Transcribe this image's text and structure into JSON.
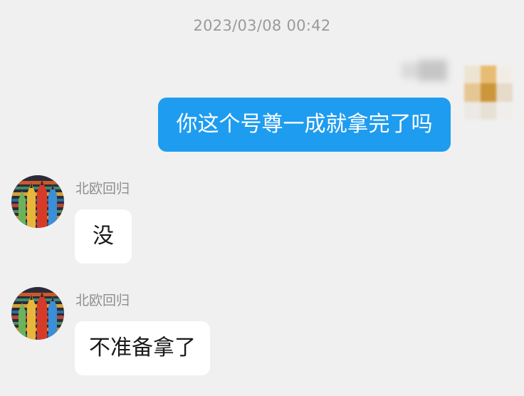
{
  "timestamp": "2023/03/08 00:42",
  "outgoing": {
    "sender_name_blurred": true,
    "avatar_blurred": true,
    "avatar_icon": "pixelated-avatar-icon",
    "bubble_color": "#1e9cf0",
    "text": "你这个号尊一成就拿完了吗"
  },
  "incoming": [
    {
      "sender": "北欧回归",
      "avatar_icon": "colored-pencils-avatar-icon",
      "text": "没"
    },
    {
      "sender": "北欧回归",
      "avatar_icon": "colored-pencils-avatar-icon",
      "text": "不准备拿了"
    }
  ],
  "colors": {
    "background": "#f0f0f0",
    "incoming_bubble": "#ffffff",
    "timestamp_text": "#9a9a9a",
    "sender_text": "#8e8e8e"
  }
}
